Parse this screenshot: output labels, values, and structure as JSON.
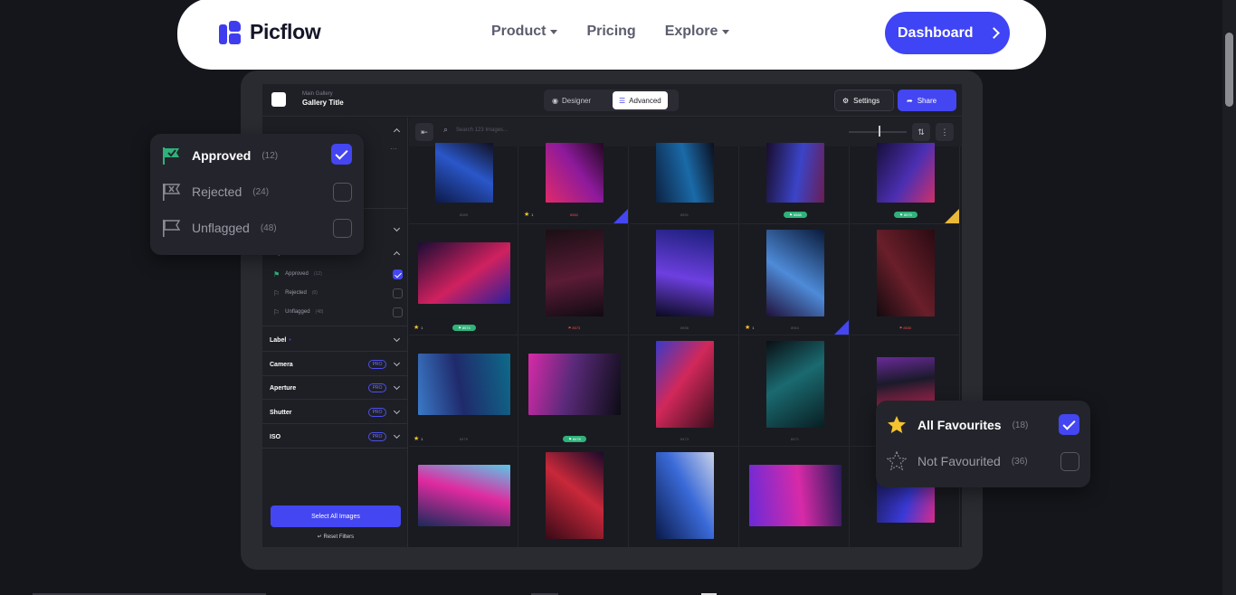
{
  "nav": {
    "brand": "Picflow",
    "menu": [
      {
        "label": "Product",
        "dropdown": true
      },
      {
        "label": "Pricing",
        "dropdown": false
      },
      {
        "label": "Explore",
        "dropdown": true
      }
    ],
    "cta": "Dashboard"
  },
  "app": {
    "gallery_sub": "Main Gallery",
    "gallery_title": "Gallery Title",
    "mode_designer": "Designer",
    "mode_advanced": "Advanced",
    "settings": "Settings",
    "share": "Share",
    "search_placeholder": "Search 123 Images...",
    "sidebar": {
      "flags_title": "Flags",
      "flags": [
        {
          "label": "Approved",
          "count": "(12)",
          "checked": true
        },
        {
          "label": "Rejected",
          "count": "(0)",
          "checked": false
        },
        {
          "label": "Unflagged",
          "count": "(48)",
          "checked": false
        }
      ],
      "label_title": "Label",
      "pro_filters": [
        {
          "label": "Camera",
          "badge": "PRO"
        },
        {
          "label": "Aperture",
          "badge": "PRO"
        },
        {
          "label": "Shutter",
          "badge": "PRO"
        },
        {
          "label": "ISO",
          "badge": "PRO"
        }
      ],
      "select_all": "Select All Images",
      "reset": "Reset Filters"
    },
    "grid": [
      {
        "id": "8585"
      },
      {
        "id": "8582",
        "stars": "1"
      },
      {
        "id": "8591"
      },
      {
        "id": "8588"
      },
      {
        "id": "8575"
      },
      {
        "id": "8574",
        "stars": "1"
      },
      {
        "id": "8573"
      },
      {
        "id": "8556"
      },
      {
        "id": "8564",
        "stars": "1"
      },
      {
        "id": "8530"
      },
      {
        "id": "8479",
        "stars": "1"
      },
      {
        "id": "8478"
      },
      {
        "id": "8473"
      },
      {
        "id": "8471"
      },
      {
        "id": ""
      },
      {
        "id": ""
      },
      {
        "id": ""
      },
      {
        "id": ""
      },
      {
        "id": ""
      },
      {
        "id": ""
      }
    ]
  },
  "flag_popover": {
    "items": [
      {
        "label": "Approved",
        "count": "(12)",
        "checked": true,
        "icon": "flag-check-icon"
      },
      {
        "label": "Rejected",
        "count": "(24)",
        "checked": false,
        "icon": "flag-x-icon"
      },
      {
        "label": "Unflagged",
        "count": "(48)",
        "checked": false,
        "icon": "flag-outline-icon"
      }
    ]
  },
  "fav_popover": {
    "items": [
      {
        "label": "All Favourites",
        "count": "(18)",
        "checked": true,
        "icon": "star-filled-icon"
      },
      {
        "label": "Not Favourited",
        "count": "(36)",
        "checked": false,
        "icon": "star-outline-icon"
      }
    ]
  },
  "colors": {
    "accent": "#4446f2",
    "approved_green": "#2fb27a",
    "rejected_red": "#ef4b4b",
    "star_gold": "#f4c430"
  }
}
